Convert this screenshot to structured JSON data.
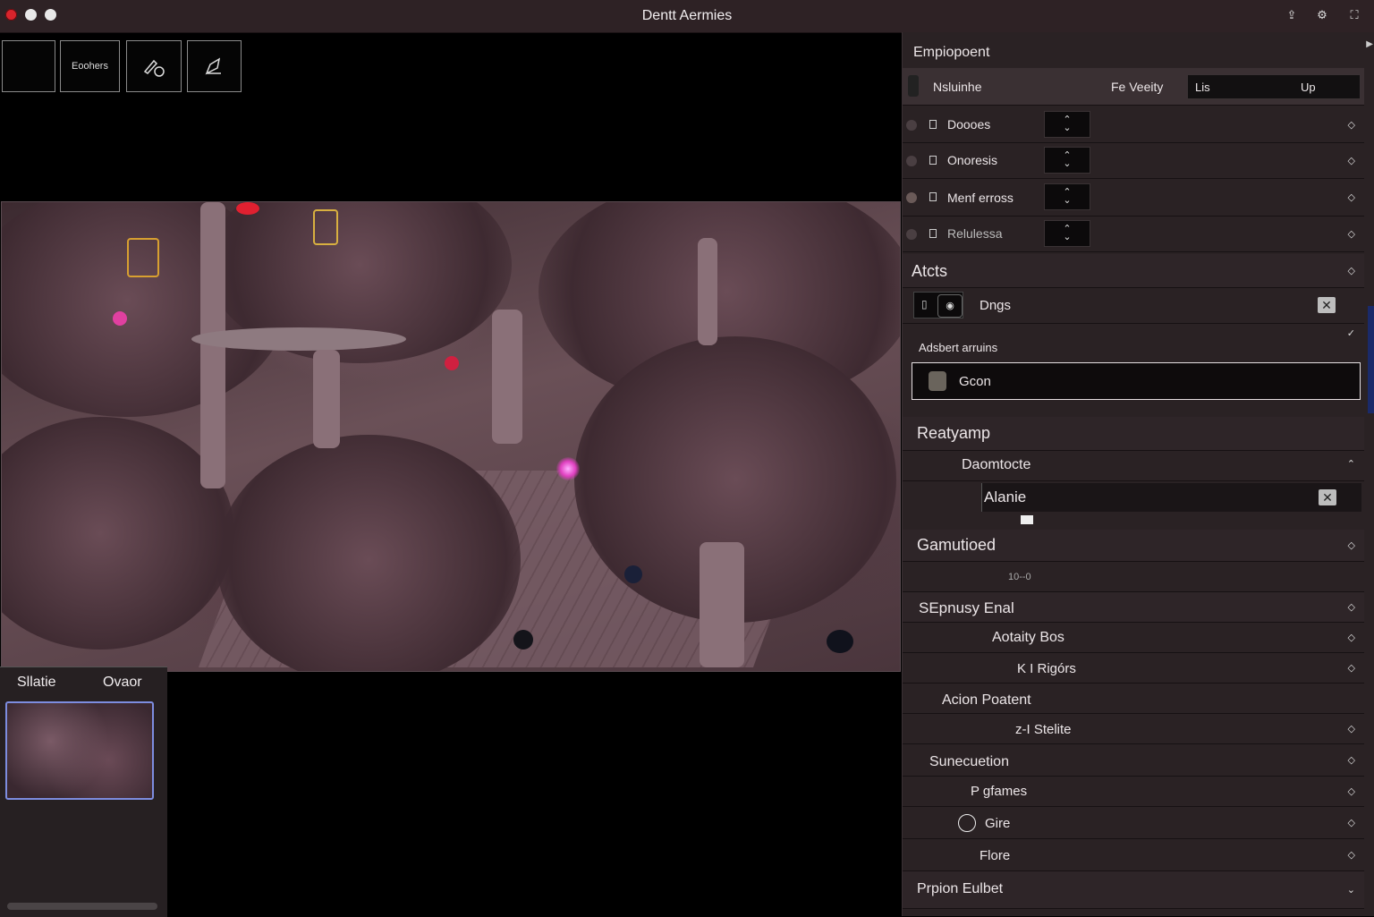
{
  "window": {
    "title": "Dentt Aermies"
  },
  "toolbar": {
    "button2_label": "Eoohers"
  },
  "bottom_panel": {
    "tab1": "Sllatie",
    "tab2": "Ovaor"
  },
  "panel": {
    "header": "Empiopoent",
    "top_row": {
      "label": "Nsluinhe",
      "mid_label": "Fe Veeity",
      "field_left": "Lis",
      "field_right": "Up"
    },
    "rows": [
      "Doooes",
      "Onoresis",
      "Menf erross",
      "Relulessa"
    ],
    "section_atcts": "Atcts",
    "dngs_label": "Dngs",
    "adjust_label": "Adsbert arruins",
    "gcon_label": "Gcon",
    "section_reatyamp": "Reatyamp",
    "daomtocte": "Daomtocte",
    "alanie": "Alanie",
    "section_gamutioed": "Gamutioed",
    "small_value": "10--0",
    "section_sepnusy": "SEpnusy Enal",
    "aotaity": "Aotaity Bos",
    "k_rigors": "K I  Rigórs",
    "acion": "Acion Poatent",
    "z_stelite": "z-I  Stelite",
    "sunecuetion": "Sunecuetion",
    "p_gfames": "P  gfames",
    "gire": "Gire",
    "flore": "Flore",
    "prpion": "Prpion Eulbet"
  }
}
